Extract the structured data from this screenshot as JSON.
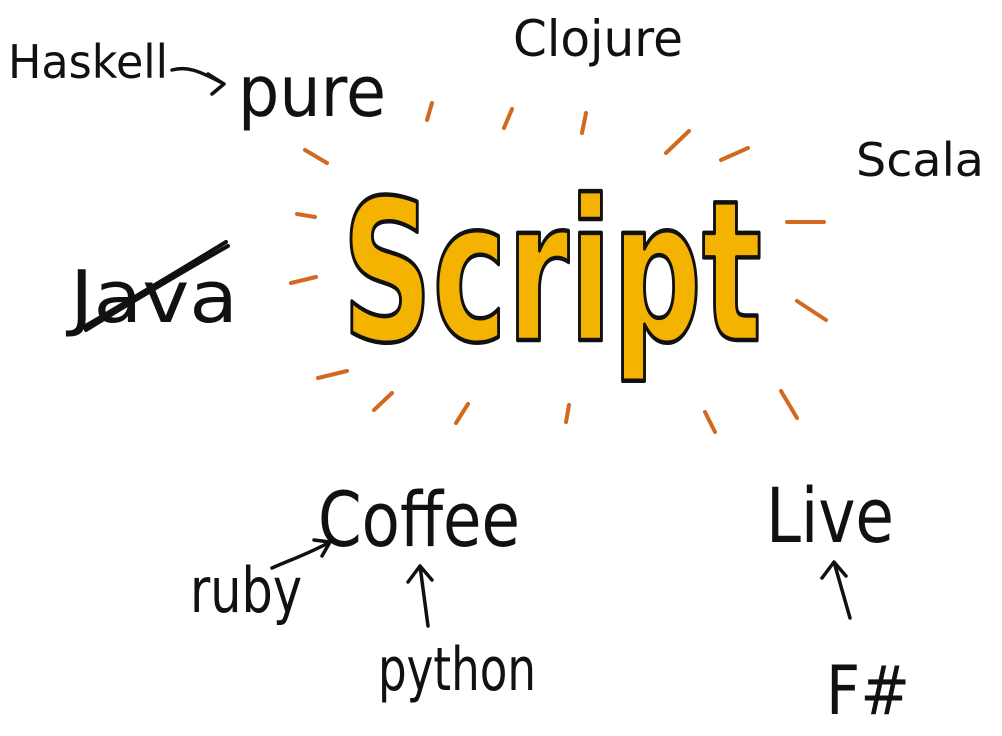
{
  "center": {
    "word": "Script",
    "fill_color": "#f5b301",
    "outline_color": "#111111",
    "ray_color": "#d2691e"
  },
  "labels": {
    "haskell": "Haskell",
    "pure": "pure",
    "clojure": "Clojure",
    "scala": "Scala",
    "java": "Java",
    "coffee": "Coffee",
    "ruby": "ruby",
    "python": "python",
    "live": "Live",
    "fsharp": "F#"
  },
  "java_struck_through": true
}
